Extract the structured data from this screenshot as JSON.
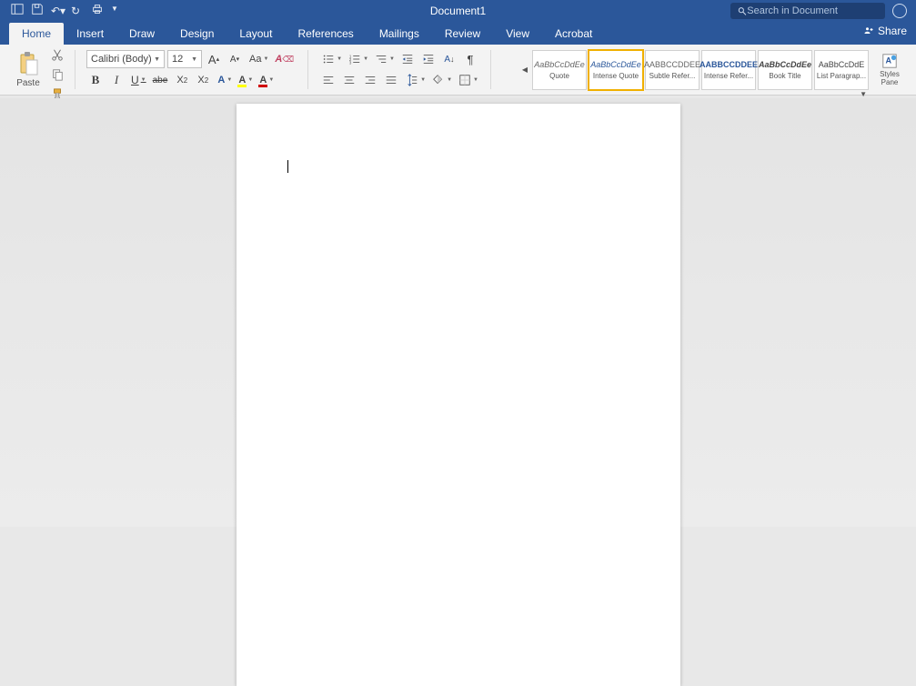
{
  "title_bar": {
    "document_title": "Document1",
    "search_placeholder": "Search in Document"
  },
  "tabs": {
    "home": "Home",
    "insert": "Insert",
    "draw": "Draw",
    "design": "Design",
    "layout": "Layout",
    "references": "References",
    "mailings": "Mailings",
    "review": "Review",
    "view": "View",
    "acrobat": "Acrobat"
  },
  "share": "Share",
  "clipboard": {
    "paste": "Paste"
  },
  "font": {
    "name": "Calibri (Body)",
    "size": "12",
    "bold": "B",
    "italic": "I",
    "underline": "U",
    "strike": "abe",
    "sub_x": "X",
    "sup_x": "X",
    "grow": "A",
    "shrink": "A",
    "case": "Aa",
    "effects": "A",
    "highlight": "A",
    "color": "A",
    "clear": "A"
  },
  "para": {
    "sort": "2↓"
  },
  "styles": {
    "sample": "AaBbCcDdEe",
    "sample_sc": "AABBCCDDEE",
    "sample_cut": "AaBbCcDdE",
    "items": [
      {
        "name": "Quote",
        "key": "quote"
      },
      {
        "name": "Intense Quote",
        "key": "intense_quote"
      },
      {
        "name": "Subtle Refer...",
        "key": "subtle_reference"
      },
      {
        "name": "Intense Refer...",
        "key": "intense_reference"
      },
      {
        "name": "Book Title",
        "key": "book_title"
      },
      {
        "name": "List Paragrap...",
        "key": "list_paragraph"
      }
    ],
    "pane": "Styles Pane"
  }
}
